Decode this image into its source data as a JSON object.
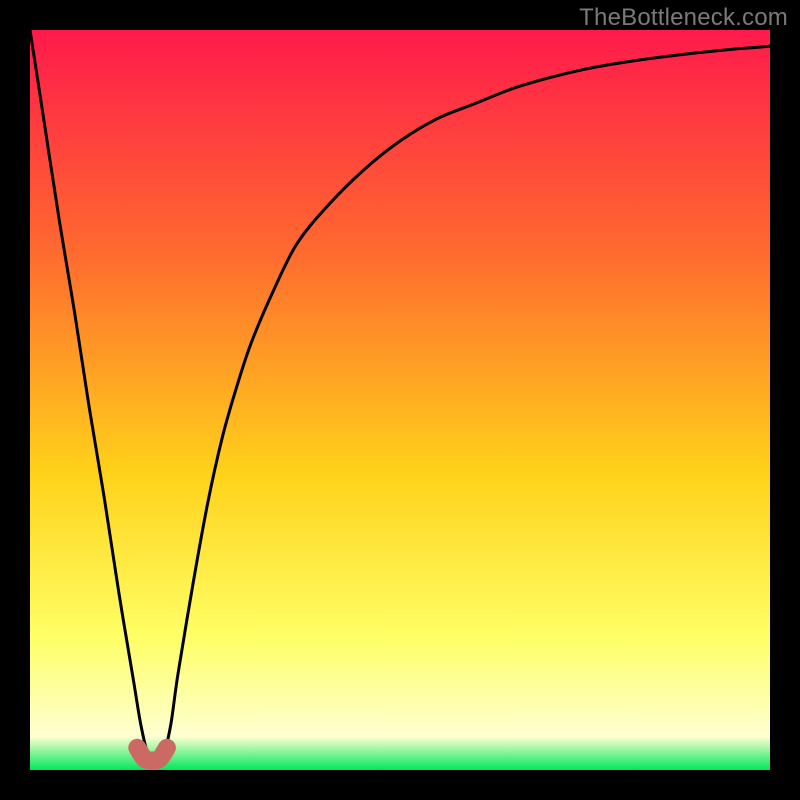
{
  "watermark": "TheBottleneck.com",
  "colors": {
    "frame": "#000000",
    "curve": "#000000",
    "marker": "#cb6a62",
    "grad_top": "#ff1a4b",
    "grad_mid1": "#ff6a2f",
    "grad_mid2": "#ffd21a",
    "grad_mid3": "#ffff66",
    "grad_mid4": "#fdffd1",
    "grad_bot": "#00e85c",
    "wm": "#7a7a7a"
  },
  "chart_data": {
    "type": "line",
    "title": "",
    "xlabel": "",
    "ylabel": "",
    "xlim": [
      0,
      100
    ],
    "ylim": [
      0,
      100
    ],
    "series": [
      {
        "name": "bottleneck-curve",
        "x": [
          0,
          2,
          4,
          6,
          8,
          10,
          12,
          14,
          15,
          16,
          17,
          18,
          19,
          20,
          22,
          24,
          26,
          28,
          30,
          33,
          36,
          40,
          45,
          50,
          55,
          60,
          65,
          70,
          75,
          80,
          85,
          90,
          95,
          100
        ],
        "y": [
          100,
          87,
          74,
          62,
          49,
          37,
          24,
          12,
          6,
          2,
          2,
          2,
          6,
          13,
          25,
          36,
          45,
          52,
          58,
          65,
          71,
          76,
          81,
          85,
          88,
          90,
          92,
          93.5,
          94.7,
          95.6,
          96.3,
          96.9,
          97.4,
          97.8
        ]
      },
      {
        "name": "optimal-marker",
        "x": [
          14.5,
          15.5,
          16.5,
          17.5,
          18.5
        ],
        "y": [
          3.0,
          1.5,
          1.3,
          1.5,
          3.0
        ]
      }
    ],
    "annotations": []
  }
}
